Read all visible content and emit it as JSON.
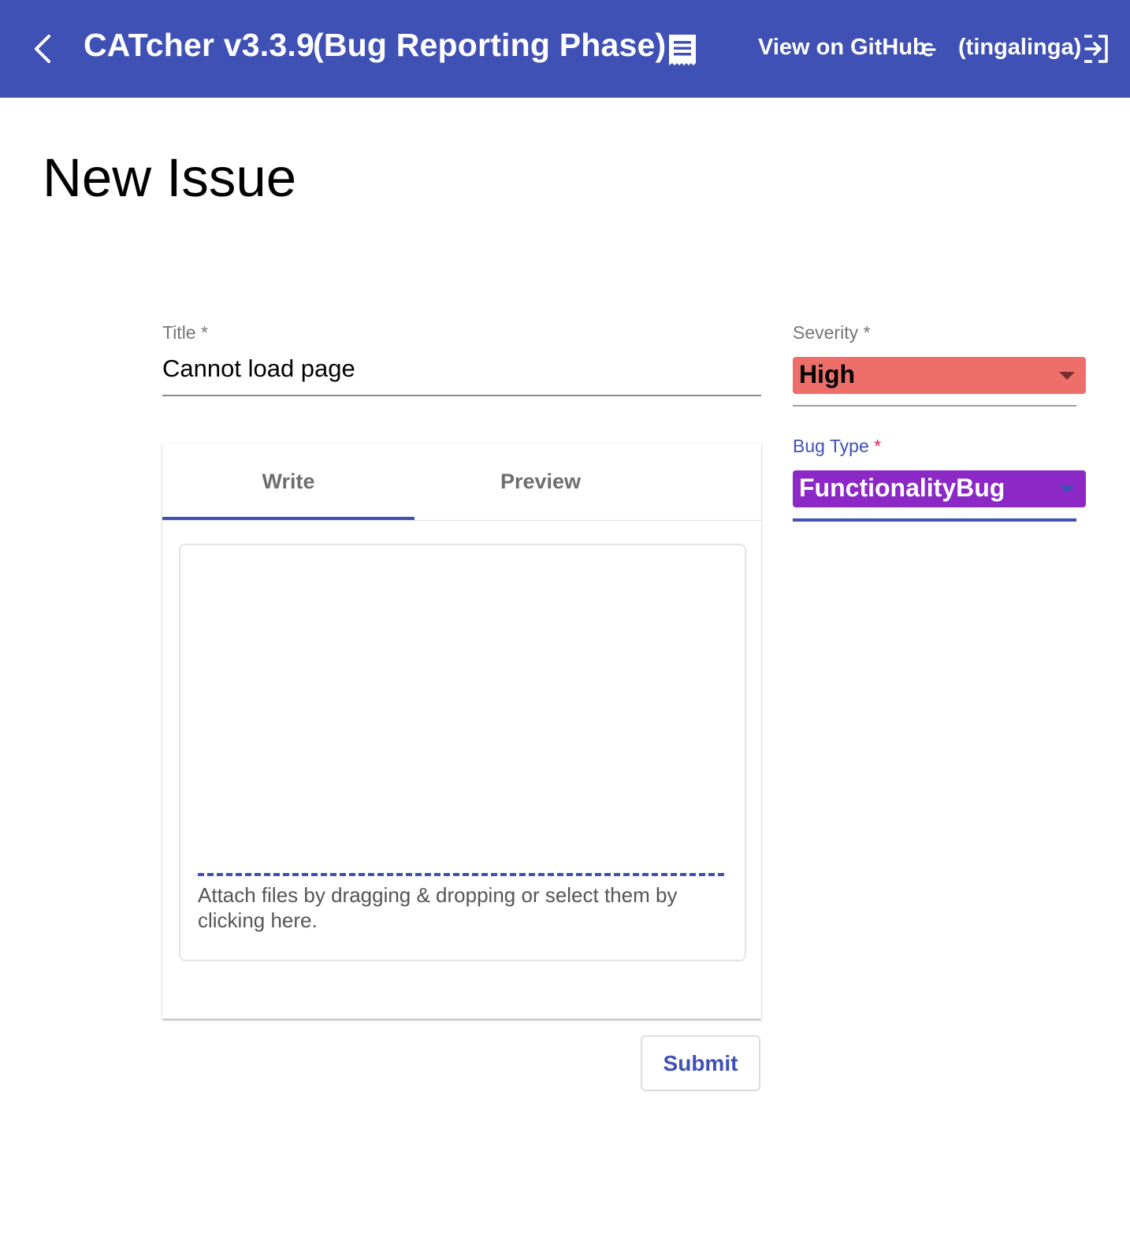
{
  "header": {
    "app_title": "CATcher v3.3.9",
    "phase": "(Bug Reporting Phase)",
    "github_link": "View on GitHub",
    "user": "(tingalinga)",
    "icons": [
      "back-arrow-icon",
      "changelog-receipt-icon",
      "github-icon",
      "logout-icon"
    ],
    "background_color": "#4051b5"
  },
  "page": {
    "heading": "New Issue"
  },
  "form": {
    "title_label": "Title",
    "title_value": "Cannot load page",
    "required_marker": "*",
    "tabs": [
      {
        "label": "Write",
        "active": true
      },
      {
        "label": "Preview",
        "active": false
      }
    ],
    "description_value": "",
    "attach_hint": "Attach files by dragging & dropping or select them by clicking here.",
    "submit_label": "Submit"
  },
  "sidebar": {
    "severity": {
      "label": "Severity",
      "value": "High",
      "color": "#ee6e6a",
      "text_color": "#000000"
    },
    "bug_type": {
      "label": "Bug Type",
      "value": "FunctionalityBug",
      "color": "#8b28c6",
      "text_color": "#ffffff",
      "focused": true
    }
  }
}
